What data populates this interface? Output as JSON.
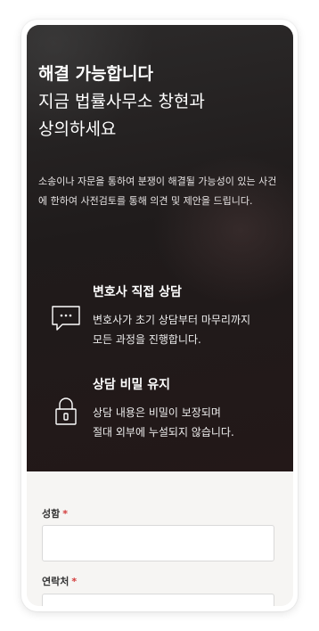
{
  "hero": {
    "title_line1": "해결 가능합니다",
    "title_line2": "지금 법률사무소 창현과",
    "title_line3": "상의하세요",
    "description": "소송이나 자문을 통하여 분쟁이 해결될 가능성이 있는 사건에 한하여 사전검토를 통해 의견 및 제안을 드립니다."
  },
  "features": [
    {
      "icon": "chat-bubble-icon",
      "title": "변호사 직접 상담",
      "description_line1": "변호사가 초기 상담부터 마무리까지",
      "description_line2": "모든 과정을 진행합니다."
    },
    {
      "icon": "lock-icon",
      "title": "상담 비밀 유지",
      "description_line1": "상담 내용은 비밀이 보장되며",
      "description_line2": "절대 외부에 누설되지 않습니다."
    }
  ],
  "form": {
    "name_label": "성함",
    "contact_label": "연락처",
    "required_mark": "*",
    "name_value": "",
    "contact_value": ""
  },
  "colors": {
    "hero_background": "#201b1b",
    "form_background": "#f6f5f3",
    "required_mark": "#d33a3a"
  }
}
